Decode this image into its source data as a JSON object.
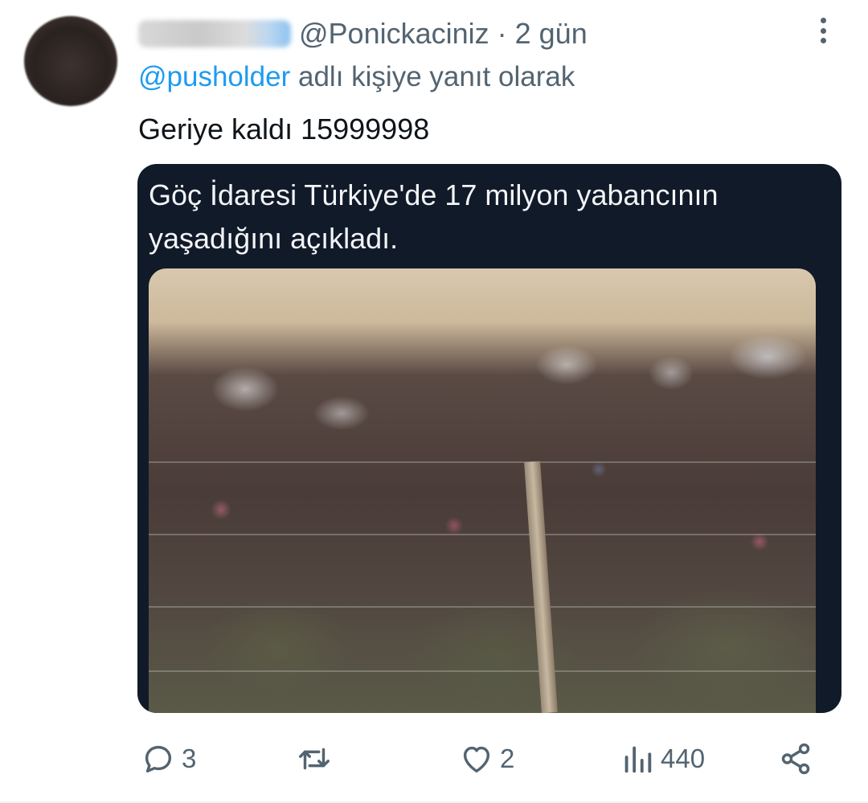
{
  "header": {
    "handle": "@Ponickaciniz",
    "separator": "·",
    "time": "2 gün"
  },
  "reply_to": {
    "mention": "@pusholder",
    "text": "adlı kişiye yanıt olarak"
  },
  "tweet": {
    "text": "Geriye kaldı 15999998"
  },
  "quoted_card": {
    "headline": "Göç İdaresi Türkiye'de 17 milyon yabancının yaşadığını açıkladı."
  },
  "actions": {
    "replies": "3",
    "retweets": "",
    "likes": "2",
    "views": "440"
  },
  "icons": {
    "reply": "reply-icon",
    "retweet": "retweet-icon",
    "like": "heart-icon",
    "views": "views-icon",
    "share": "share-icon",
    "more": "more-icon"
  },
  "colors": {
    "accent": "#1d9bf0",
    "muted": "#536471",
    "text": "#0f1419",
    "card_bg": "#111a29"
  }
}
